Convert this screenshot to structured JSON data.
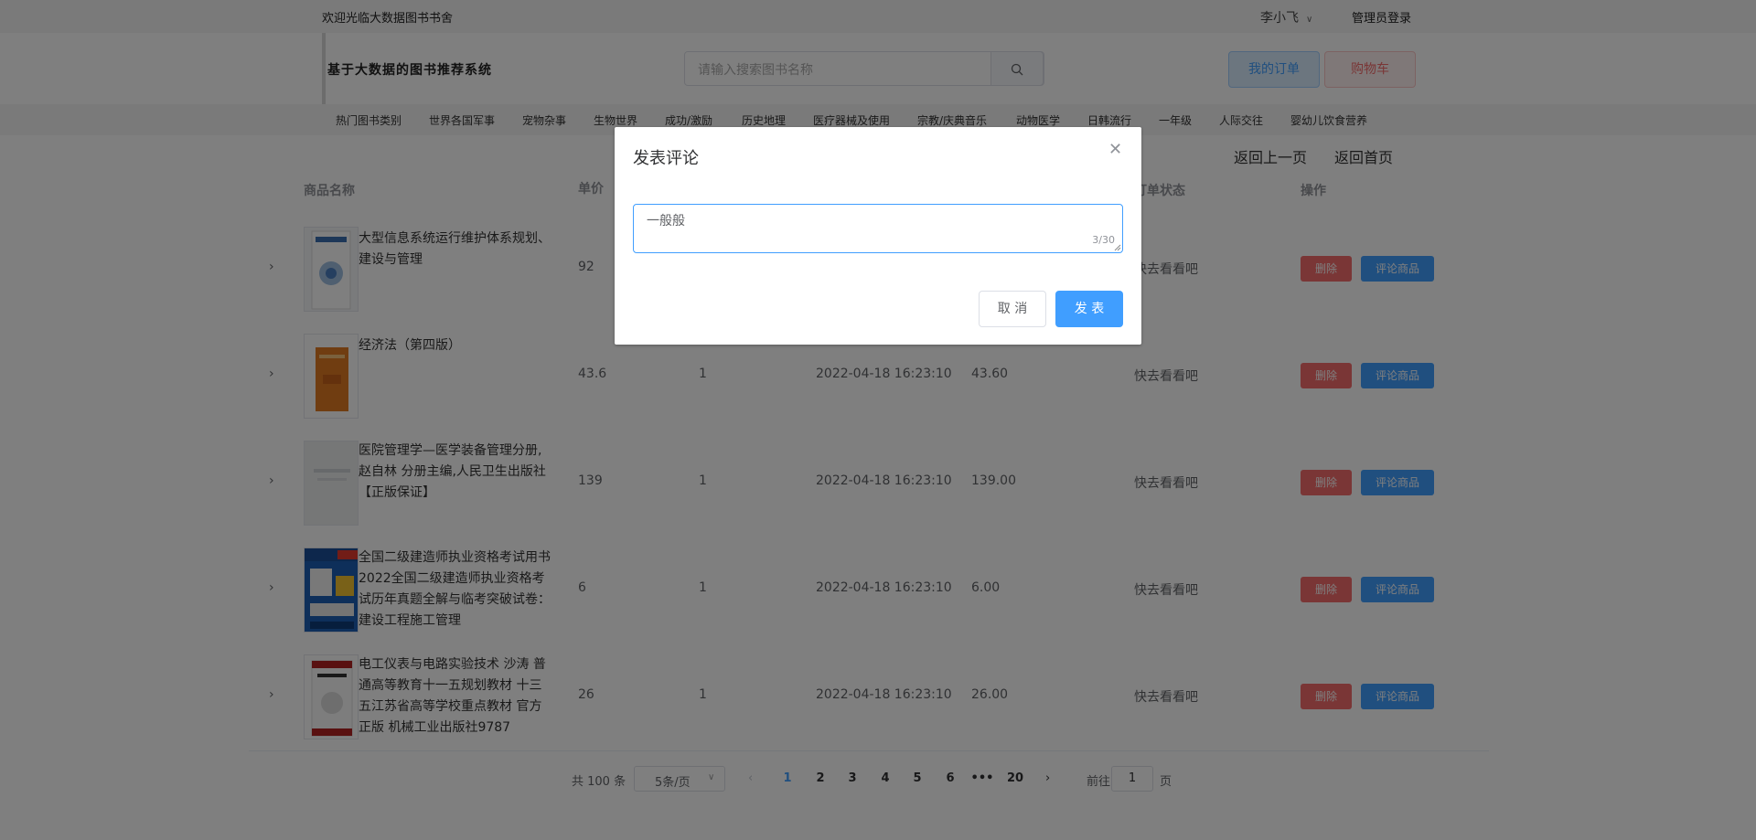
{
  "topbar": {
    "welcome": "欢迎光临大数据图书书舍",
    "user": "李小飞",
    "admin": "管理员登录"
  },
  "header": {
    "brand": "基于大数据的图书推荐系统",
    "search_placeholder": "请输入搜索图书名称",
    "orders": "我的订单",
    "cart": "购物车"
  },
  "categories": [
    "热门图书类别",
    "世界各国军事",
    "宠物杂事",
    "生物世界",
    "成功/激励",
    "历史地理",
    "医疗器械及使用",
    "宗教/庆典音乐",
    "动物医学",
    "日韩流行",
    "一年级",
    "人际交往",
    "婴幼儿饮食营养"
  ],
  "back": {
    "prev": "返回上一页",
    "home": "返回首页"
  },
  "table": {
    "headers": {
      "name": "商品名称",
      "price": "单价",
      "status": "订单状态",
      "action": "操作"
    },
    "rows": [
      {
        "name": "大型信息系统运行维护体系规划、建设与管理",
        "price": "92",
        "qty": "",
        "time": "",
        "total": "",
        "status": "快去看看吧"
      },
      {
        "name": "经济法（第四版）",
        "price": "43.6",
        "qty": "1",
        "time": "2022-04-18 16:23:10",
        "total": "43.60",
        "status": "快去看看吧"
      },
      {
        "name": "医院管理学—医学装备管理分册,赵自林 分册主编,人民卫生出版社【正版保证】",
        "price": "139",
        "qty": "1",
        "time": "2022-04-18 16:23:10",
        "total": "139.00",
        "status": "快去看看吧"
      },
      {
        "name": "全国二级建造师执业资格考试用书2022全国二级建造师执业资格考试历年真题全解与临考突破试卷：建设工程施工管理",
        "price": "6",
        "qty": "1",
        "time": "2022-04-18 16:23:10",
        "total": "6.00",
        "status": "快去看看吧"
      },
      {
        "name": "电工仪表与电路实验技术 沙涛 普通高等教育十一五规划教材 十三五江苏省高等学校重点教材 官方正版 机械工业出版社9787",
        "price": "26",
        "qty": "1",
        "time": "2022-04-18 16:23:10",
        "total": "26.00",
        "status": "快去看看吧"
      }
    ],
    "delete_label": "删除",
    "comment_label": "评论商品"
  },
  "pagination": {
    "total": "共 100 条",
    "page_size": "5条/页",
    "pages": [
      "1",
      "2",
      "3",
      "4",
      "5",
      "6",
      "•••",
      "20"
    ],
    "current_page": "1",
    "goto": "前往",
    "goto_value": "1",
    "goto_unit": "页"
  },
  "dialog": {
    "title": "发表评论",
    "textarea_value": "一般般",
    "counter": "3/30",
    "cancel": "取 消",
    "submit": "发 表"
  },
  "colors": {
    "primary": "#409eff",
    "danger": "#f56c6c",
    "mask": "rgba(0,0,0,0.5)"
  }
}
